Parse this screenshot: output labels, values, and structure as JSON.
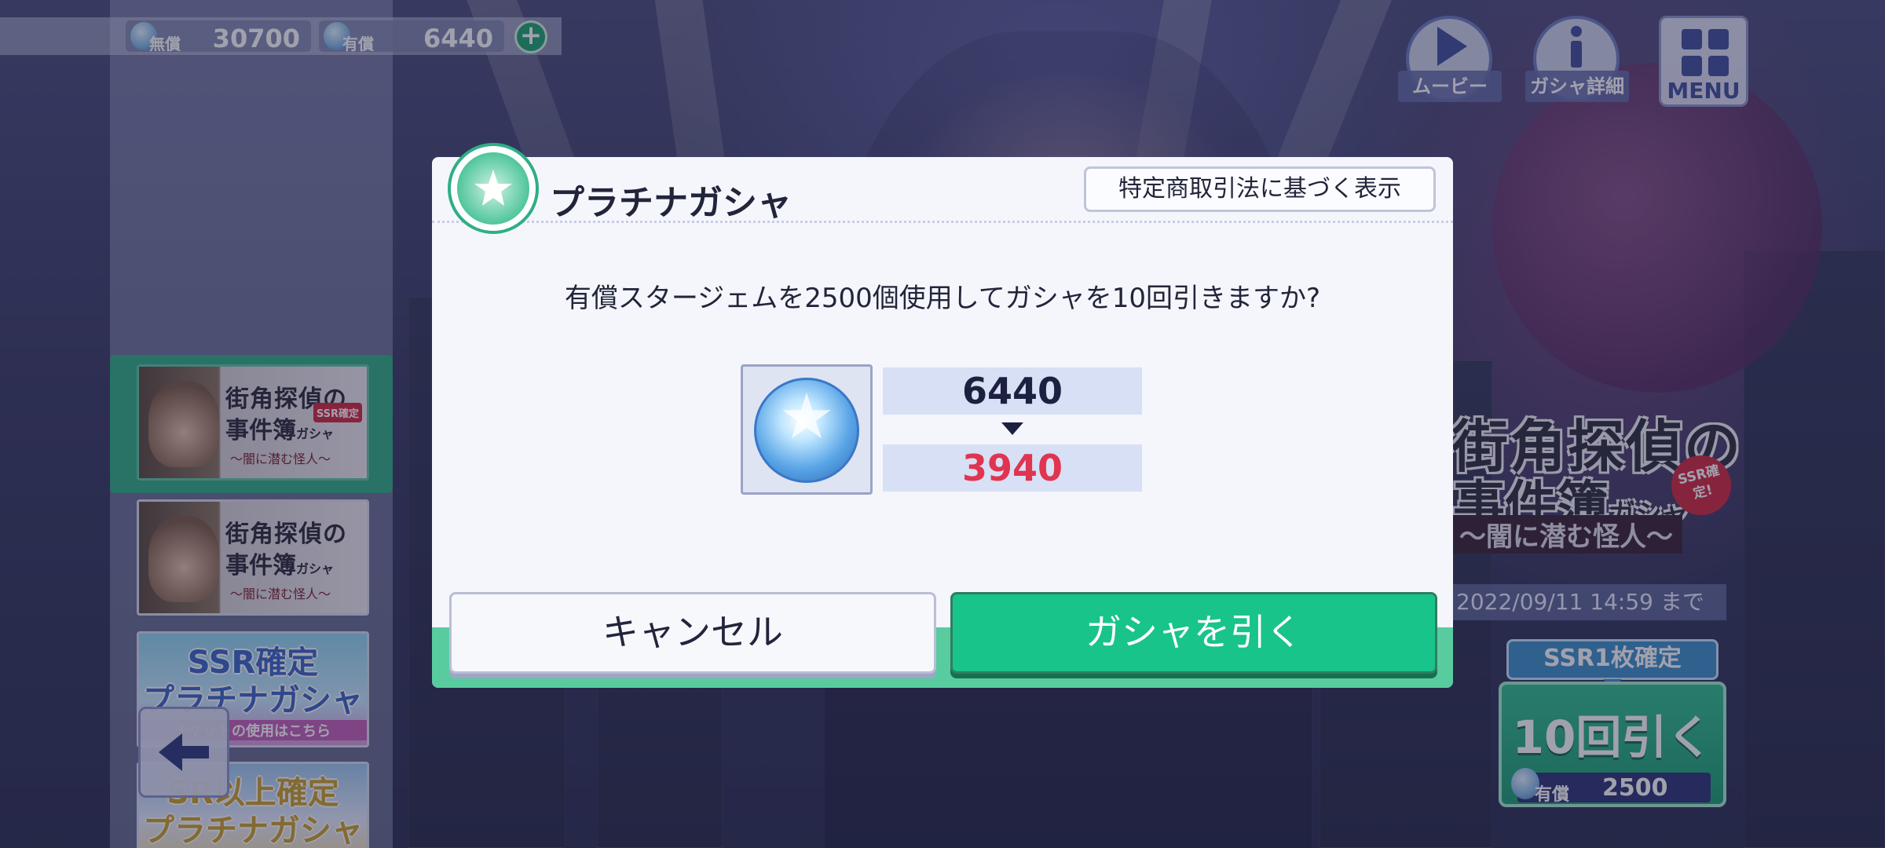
{
  "currency": {
    "free_label": "無償",
    "free_value": "30700",
    "paid_label": "有償",
    "paid_value": "6440"
  },
  "top_right": {
    "movie_label": "ムービー",
    "detail_label": "ガシャ詳細",
    "menu_label": "MENU"
  },
  "banners": [
    {
      "title1": "街角探偵の",
      "title2": "事件簿",
      "suffix": "ガシャ",
      "sub": "〜闇に潜む怪人〜",
      "tag": "SSR確定"
    },
    {
      "title1": "街角探偵の",
      "title2": "事件簿",
      "suffix": "ガシャ",
      "sub": "〜闇に潜む怪人〜"
    },
    {
      "title1": "SSR確定",
      "title2": "プラチナガシャ",
      "sub": "チケットの使用はこちら"
    },
    {
      "title1": "SR以上確定",
      "title2": "プラチナガシャ"
    }
  ],
  "feature": {
    "title1": "街角探偵の",
    "title2": "事件簿",
    "suffix": "ガシャ",
    "sub": "〜闇に潜む怪人〜",
    "ssr_badge": "SSR確定!",
    "period": "2022/09/11 14:59 まで",
    "pull_tag": "SSR1枚確定",
    "pull_label": "10回引く",
    "cost_label": "有償",
    "cost_value": "2500"
  },
  "dialog": {
    "title": "プラチナガシャ",
    "law_button": "特定商取引法に基づく表示",
    "question": "有償スタージェムを2500個使用してガシャを10回引きますか?",
    "before": "6440",
    "after": "3940",
    "cancel": "キャンセル",
    "confirm": "ガシャを引く"
  },
  "colors": {
    "accent_green": "#18c48a",
    "after_red": "#e03451",
    "gem_blue": "#58a4e6"
  }
}
